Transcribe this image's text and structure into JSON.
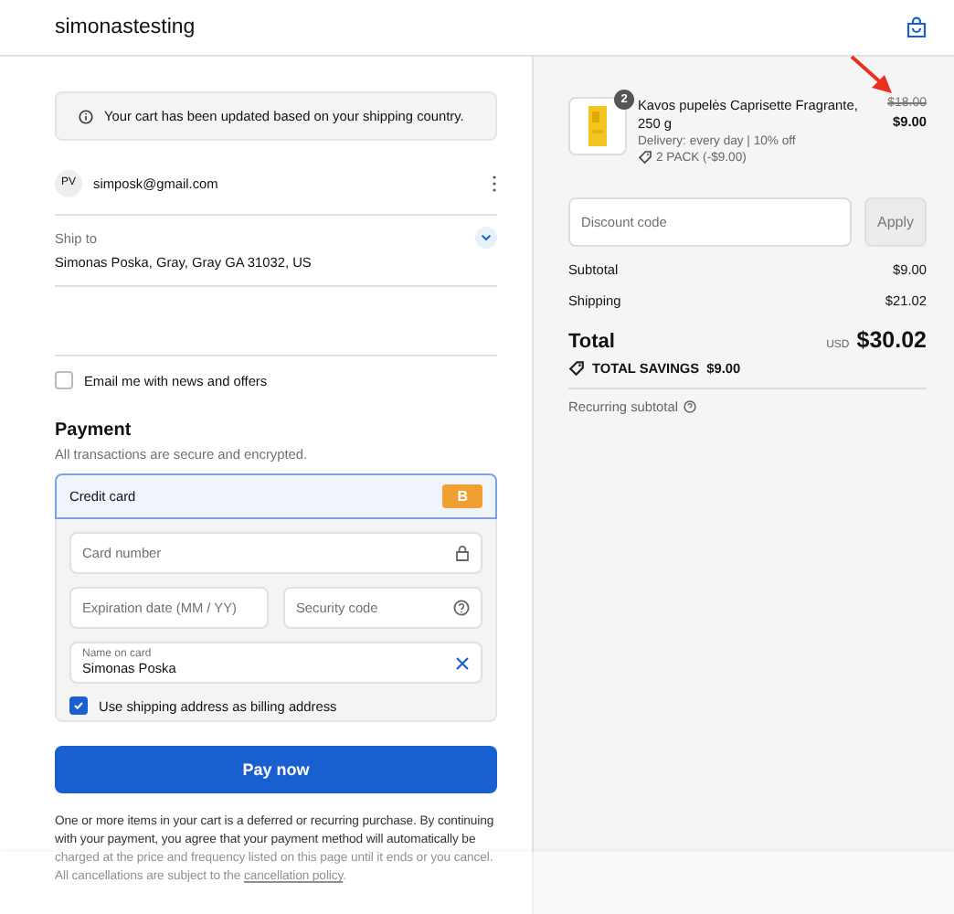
{
  "header": {
    "store_name": "simonastesting"
  },
  "notice": {
    "text": "Your cart has been updated based on your shipping country."
  },
  "contact": {
    "initials": "PV",
    "email": "simposk@gmail.com"
  },
  "ship_to": {
    "label": "Ship to",
    "address": "Simonas Poska, Gray, Gray GA 31032, US"
  },
  "newsletter": {
    "label": "Email me with news and offers",
    "checked": false
  },
  "payment": {
    "title": "Payment",
    "subtitle": "All transactions are secure and encrypted.",
    "method": {
      "label": "Credit card",
      "badge": "B",
      "selected": true
    },
    "fields": [
      {
        "kind": "lock",
        "placeholder": "Card number"
      },
      {
        "kind": "plain",
        "placeholder": "Expiration date (MM / YY)"
      },
      {
        "kind": "help",
        "placeholder": "Security code"
      },
      {
        "kind": "clearable",
        "label": "Name on card",
        "value": "Simonas Poska"
      }
    ],
    "billing": {
      "label": "Use shipping address as billing address",
      "checked": true
    }
  },
  "pay_button": "Pay now",
  "disclaimer": {
    "text": "One or more items in your cart is a deferred or recurring purchase. By continuing with your payment, you agree that your payment method will automatically be charged at the price and frequency listed on this page until it ends or you cancel. All cancellations are subject to the ",
    "link": "cancellation policy",
    "end": "."
  },
  "summary": {
    "item": {
      "quantity": "2",
      "name": "Kavos pupelės Caprisette Fragrante, 250 g",
      "delivery": "Delivery: every day | 10% off",
      "discount": "2 PACK (-$9.00)",
      "original_price": "$18.00",
      "price": "$9.00"
    },
    "discount_field": {
      "placeholder": "Discount code",
      "button": "Apply"
    },
    "lines": [
      {
        "label": "Subtotal",
        "value": "$9.00"
      },
      {
        "label": "Shipping",
        "value": "$21.02"
      }
    ],
    "total": {
      "label": "Total",
      "currency": "USD",
      "amount": "$30.02"
    },
    "savings": {
      "label": "TOTAL SAVINGS",
      "amount": "$9.00"
    },
    "recurring": "Recurring subtotal"
  }
}
